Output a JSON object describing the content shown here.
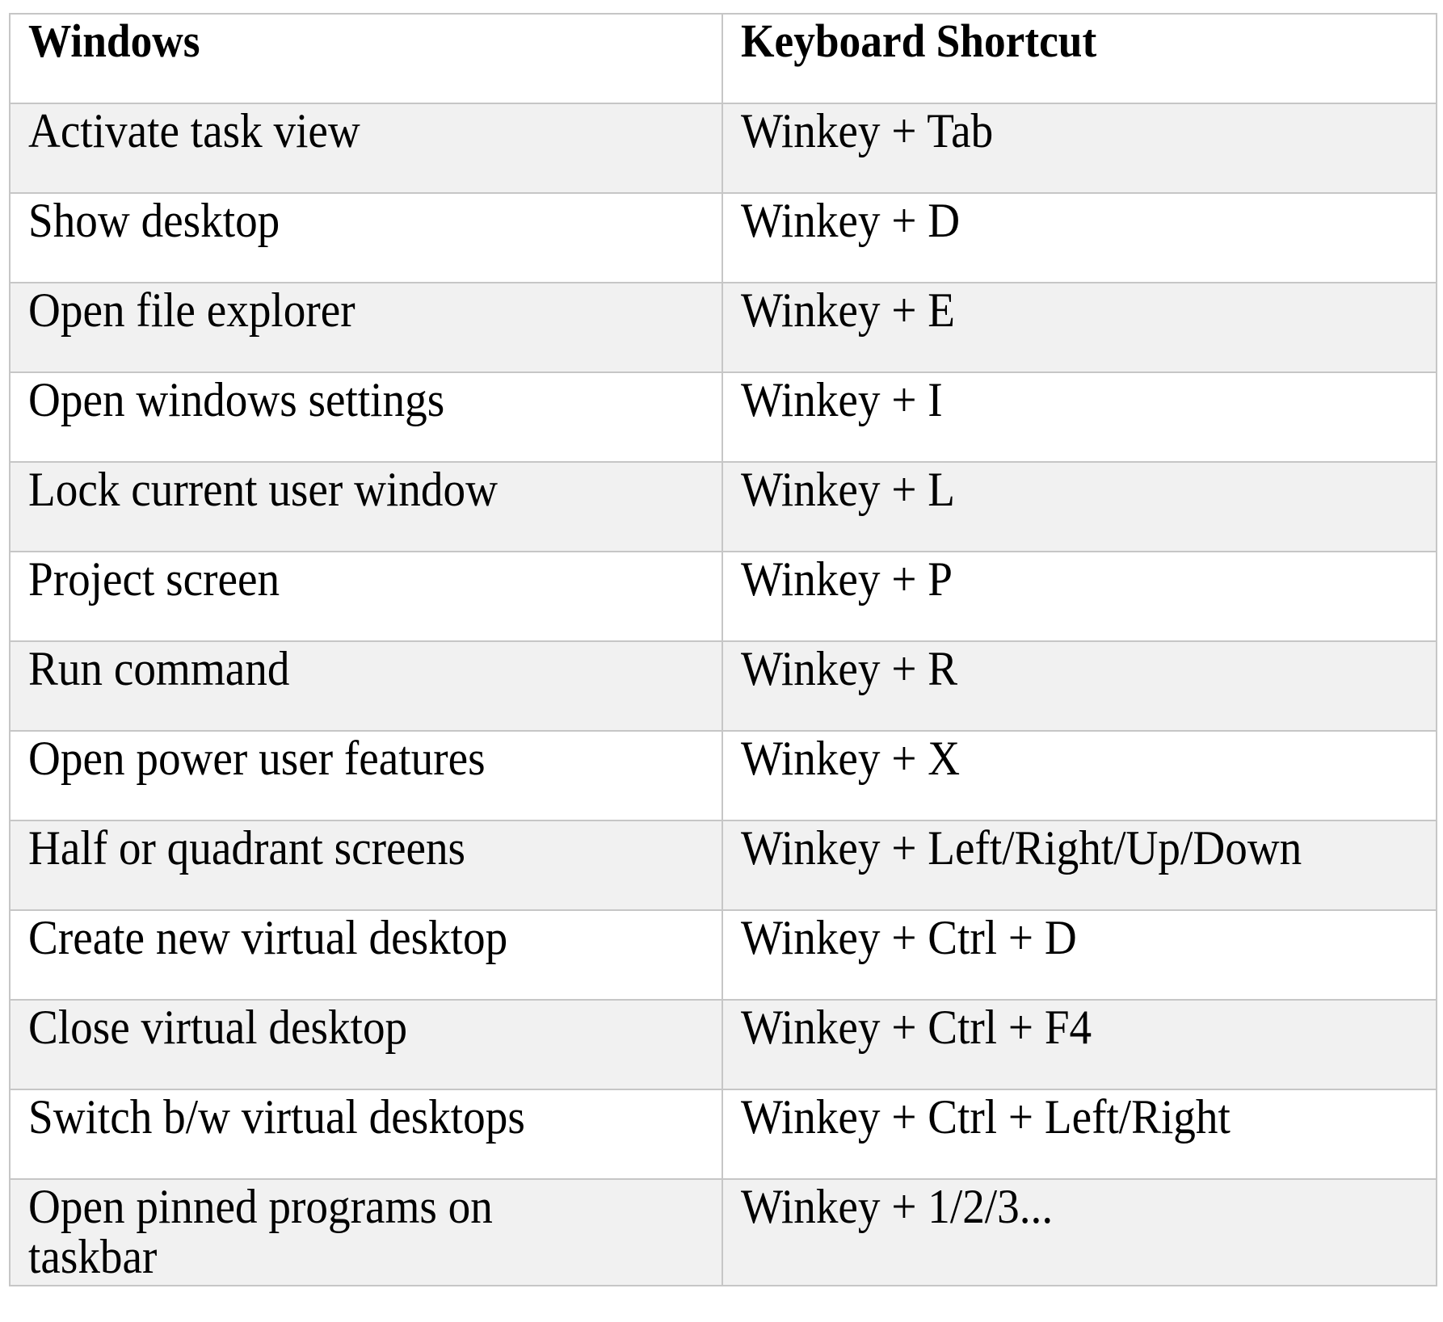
{
  "table": {
    "headers": [
      "Windows",
      "Keyboard Shortcut"
    ],
    "rows": [
      {
        "action": "Activate task view",
        "shortcut": "Winkey + Tab"
      },
      {
        "action": "Show desktop",
        "shortcut": "Winkey + D"
      },
      {
        "action": "Open file explorer",
        "shortcut": "Winkey + E"
      },
      {
        "action": "Open windows settings",
        "shortcut": "Winkey + I"
      },
      {
        "action": "Lock current user window",
        "shortcut": "Winkey + L"
      },
      {
        "action": "Project screen",
        "shortcut": "Winkey + P"
      },
      {
        "action": "Run command",
        "shortcut": "Winkey + R"
      },
      {
        "action": "Open power user features",
        "shortcut": "Winkey + X"
      },
      {
        "action": "Half or quadrant screens",
        "shortcut": "Winkey + Left/Right/Up/Down"
      },
      {
        "action": "Create new virtual desktop",
        "shortcut": "Winkey + Ctrl + D"
      },
      {
        "action": "Close virtual desktop",
        "shortcut": "Winkey + Ctrl + F4"
      },
      {
        "action": "Switch b/w virtual desktops",
        "shortcut": "Winkey + Ctrl + Left/Right"
      },
      {
        "action": "Open pinned programs on taskbar",
        "shortcut": "Winkey + 1/2/3..."
      }
    ]
  },
  "colors": {
    "border": "#c6c6c6",
    "alt_row_bg": "#f1f1f1",
    "row_bg": "#ffffff",
    "text": "#000000"
  }
}
